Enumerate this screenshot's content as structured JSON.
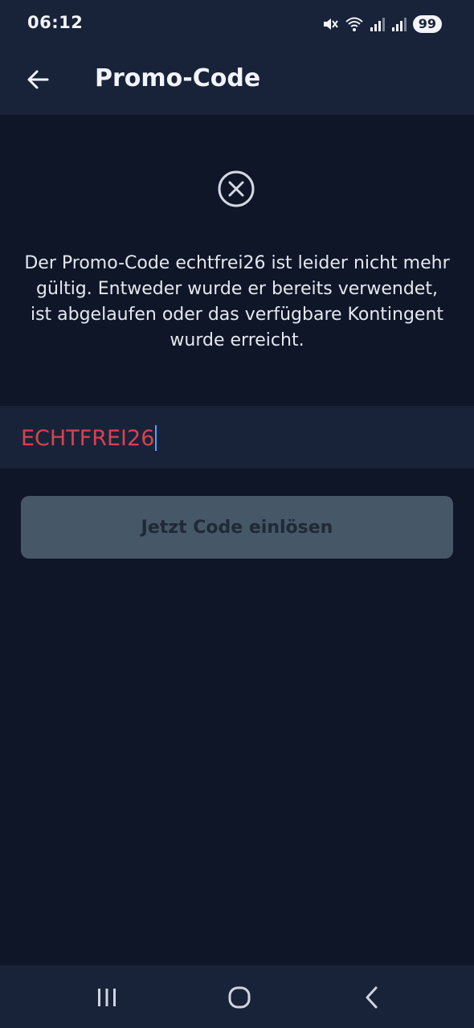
{
  "status_bar": {
    "time": "06:12",
    "battery": "99",
    "icons": [
      "mute-icon",
      "wifi-icon",
      "signal-icon",
      "signal-icon-2"
    ]
  },
  "app_bar": {
    "title": "Promo-Code",
    "back_icon": "arrow-left-icon"
  },
  "error": {
    "icon": "close-circle-icon",
    "message": "Der Promo-Code echtfrei26 ist leider nicht mehr gültig. Entweder wurde er bereits verwendet, ist abgelaufen oder das verfügbare Kontingent wurde erreicht."
  },
  "code_input": {
    "value": "ECHTFREI26",
    "error_color": "#d9424f"
  },
  "redeem_button": {
    "label": "Jetzt Code einlösen"
  },
  "nav_bar": {
    "icons": [
      "recents-icon",
      "home-icon",
      "back-icon"
    ]
  },
  "colors": {
    "background": "#0f1628",
    "surface": "#18233a",
    "button_disabled": "#465767",
    "caret": "#4aa3ff"
  }
}
